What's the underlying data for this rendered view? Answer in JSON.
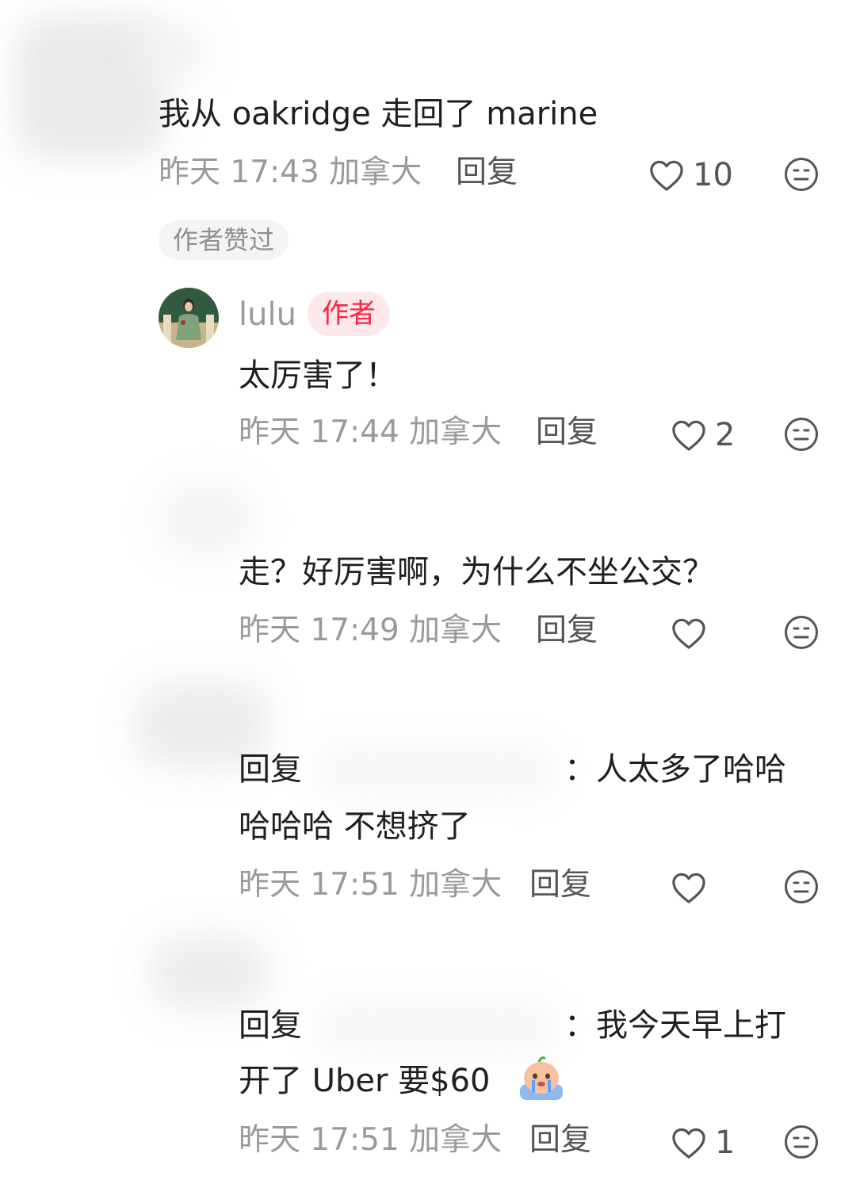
{
  "comments": [
    {
      "text": "我从 oakridge 走回了 marine",
      "time": "昨天 17:43 加拿大",
      "reply_label": "回复",
      "likes": "10",
      "badge": "作者赞过"
    },
    {
      "username": "lulu",
      "author_tag": "作者",
      "text": "太厉害了！",
      "time": "昨天 17:44 加拿大",
      "reply_label": "回复",
      "likes": "2"
    },
    {
      "text": "走？好厉害啊，为什么不坐公交？",
      "time": "昨天 17:49 加拿大",
      "reply_label": "回复",
      "likes": ""
    },
    {
      "reply_prefix": "回复",
      "text_line1": "：人太多了哈哈",
      "text_line2": "哈哈哈 不想挤了",
      "time": "昨天 17:51 加拿大",
      "reply_label": "回复",
      "likes": ""
    },
    {
      "reply_prefix": "回复",
      "text_line1": "：我今天早上打",
      "text_line2": "开了 Uber 要$60",
      "time": "昨天 17:51 加拿大",
      "reply_label": "回复",
      "likes": "1"
    }
  ],
  "icons": {
    "like": "heart-outline-icon",
    "emoji": "neutral-face-icon",
    "crying": "crying-emoji-icon"
  },
  "colors": {
    "accent": "#ff2442",
    "meta": "#9a9a9a",
    "text": "#1f1f1f"
  }
}
